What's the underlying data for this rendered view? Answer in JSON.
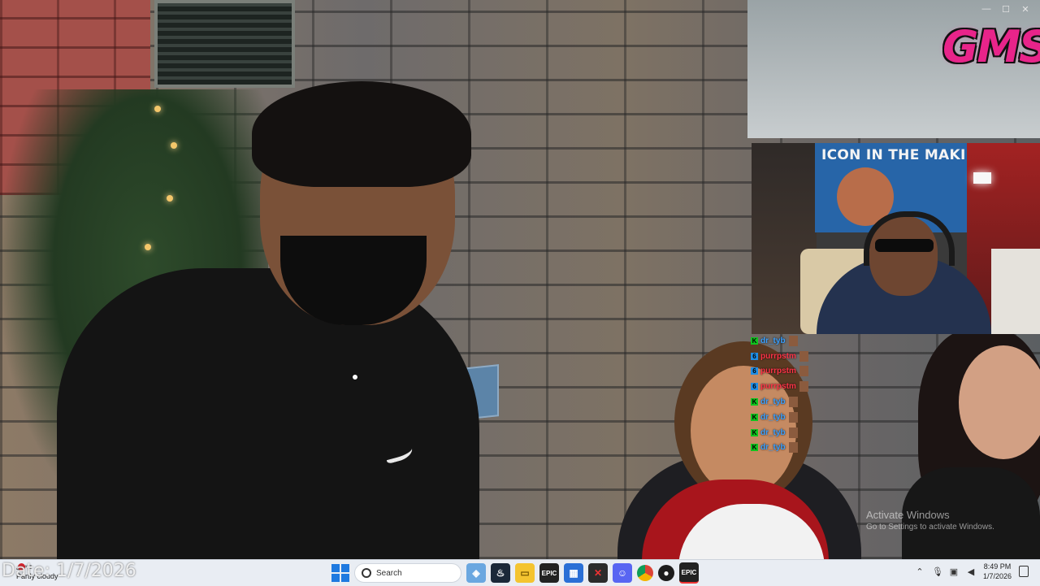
{
  "window": {
    "minimize": "—",
    "maximize": "☐",
    "close": "✕"
  },
  "logo": {
    "text": "GMS"
  },
  "webcam": {
    "banner_text": "ICON IN THE MAKIN"
  },
  "chat": {
    "messages": [
      {
        "badge": "K",
        "user": "dr_tyb",
        "color": "blue"
      },
      {
        "badge": "6",
        "user": "purrpstm",
        "color": "red"
      },
      {
        "badge": "6",
        "user": "purrpstm",
        "color": "red"
      },
      {
        "badge": "6",
        "user": "purrpstm",
        "color": "red"
      },
      {
        "badge": "K",
        "user": "dr_tyb",
        "color": "blue"
      },
      {
        "badge": "K",
        "user": "dr_tyb",
        "color": "blue"
      },
      {
        "badge": "K",
        "user": "dr_tyb",
        "color": "blue"
      },
      {
        "badge": "K",
        "user": "dr_tyb",
        "color": "blue"
      }
    ]
  },
  "watermark": {
    "title": "Activate Windows",
    "subtitle": "Go to Settings to activate Windows."
  },
  "overlay_date": "Date: 1/7/2026",
  "taskbar": {
    "weather_temp": "43°F",
    "weather_desc": "Partly cloudy",
    "search_placeholder": "Search",
    "apps": [
      "steam-icon",
      "file-explorer-icon",
      "epic-games-icon",
      "app-icon",
      "x-app-icon",
      "discord-icon",
      "chrome-icon",
      "obs-icon",
      "epic-games-icon"
    ],
    "time": "8:49 PM",
    "date": "1/7/2026"
  },
  "colors": {
    "logo": "#e8248a",
    "chat_name": "#3aa0ff",
    "chat_name_alt": "#ff3347",
    "taskbar": "#e9edf3"
  }
}
